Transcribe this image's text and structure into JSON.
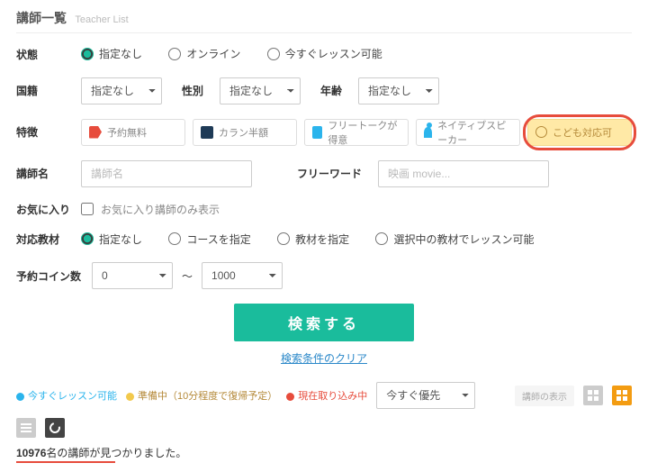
{
  "title": {
    "jp": "講師一覧",
    "en": "Teacher List"
  },
  "labels": {
    "status": "状態",
    "nationality": "国籍",
    "gender": "性別",
    "age": "年齢",
    "feature": "特徴",
    "teacher_name": "講師名",
    "freeword": "フリーワード",
    "favorite": "お気に入り",
    "materials": "対応教材",
    "coins": "予約コイン数"
  },
  "status_opts": [
    "指定なし",
    "オンライン",
    "今すぐレッスン可能"
  ],
  "none_opt": "指定なし",
  "features": [
    "予約無料",
    "カラン半額",
    "フリートークが得意",
    "ネイティブスピーカー",
    "こども対応可"
  ],
  "placeholders": {
    "teacher": "講師名",
    "freeword": "映画 movie..."
  },
  "favorite_chk": "お気に入り講師のみ表示",
  "material_opts": [
    "指定なし",
    "コースを指定",
    "教材を指定",
    "選択中の教材でレッスン可能"
  ],
  "coin": {
    "min": "0",
    "sep": "～",
    "max": "1000"
  },
  "search_btn": "検索する",
  "clear_link": "検索条件のクリア",
  "legend": {
    "now": "今すぐレッスン可能",
    "prep": "準備中（10分程度で復帰予定）",
    "busy": "現在取り込み中"
  },
  "sort_opt": "今すぐ優先",
  "view_label": "講師の表示",
  "result": {
    "count": "10976",
    "suffix": "名の講師が見つかりました。"
  }
}
